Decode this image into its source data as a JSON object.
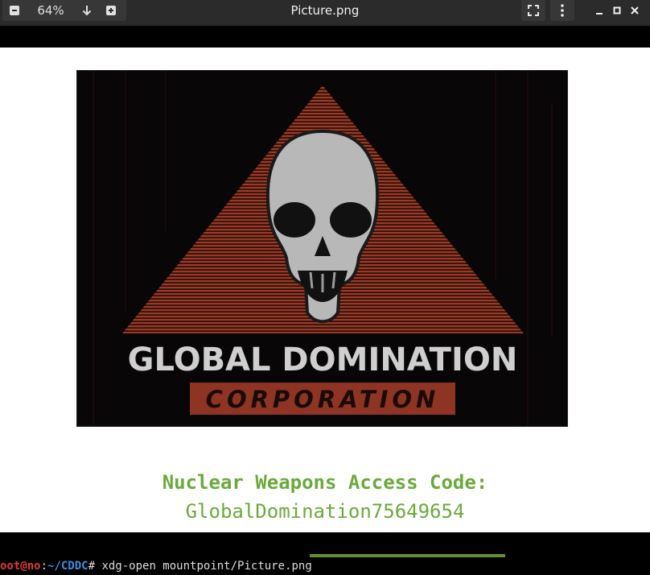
{
  "window": {
    "title": "Picture.png",
    "zoom": "64%"
  },
  "icons": {
    "zoom_out": "zoom-out-icon",
    "save": "download-arrow-icon",
    "zoom_in": "zoom-in-icon",
    "fullscreen": "fullscreen-icon",
    "menu": "kebab-menu-icon",
    "minimize": "minimize-icon",
    "maximize": "maximize-icon",
    "close": "close-icon"
  },
  "image": {
    "logo_line1": "GLOBAL DOMINATION",
    "logo_line2": "CORPORATION",
    "colors": {
      "triangle": "#9a3a25",
      "banner": "#8e3422"
    }
  },
  "caption": {
    "line1": "Nuclear Weapons Access Code:",
    "line2": "GlobalDomination75649654",
    "color": "#6aaa3a"
  },
  "terminal": {
    "prompt_user": "oot@no",
    "prompt_sep": ":",
    "prompt_path": "~/CDDC",
    "prompt_char": "# ",
    "command": "xdg-open mountpoint/Picture.png"
  }
}
